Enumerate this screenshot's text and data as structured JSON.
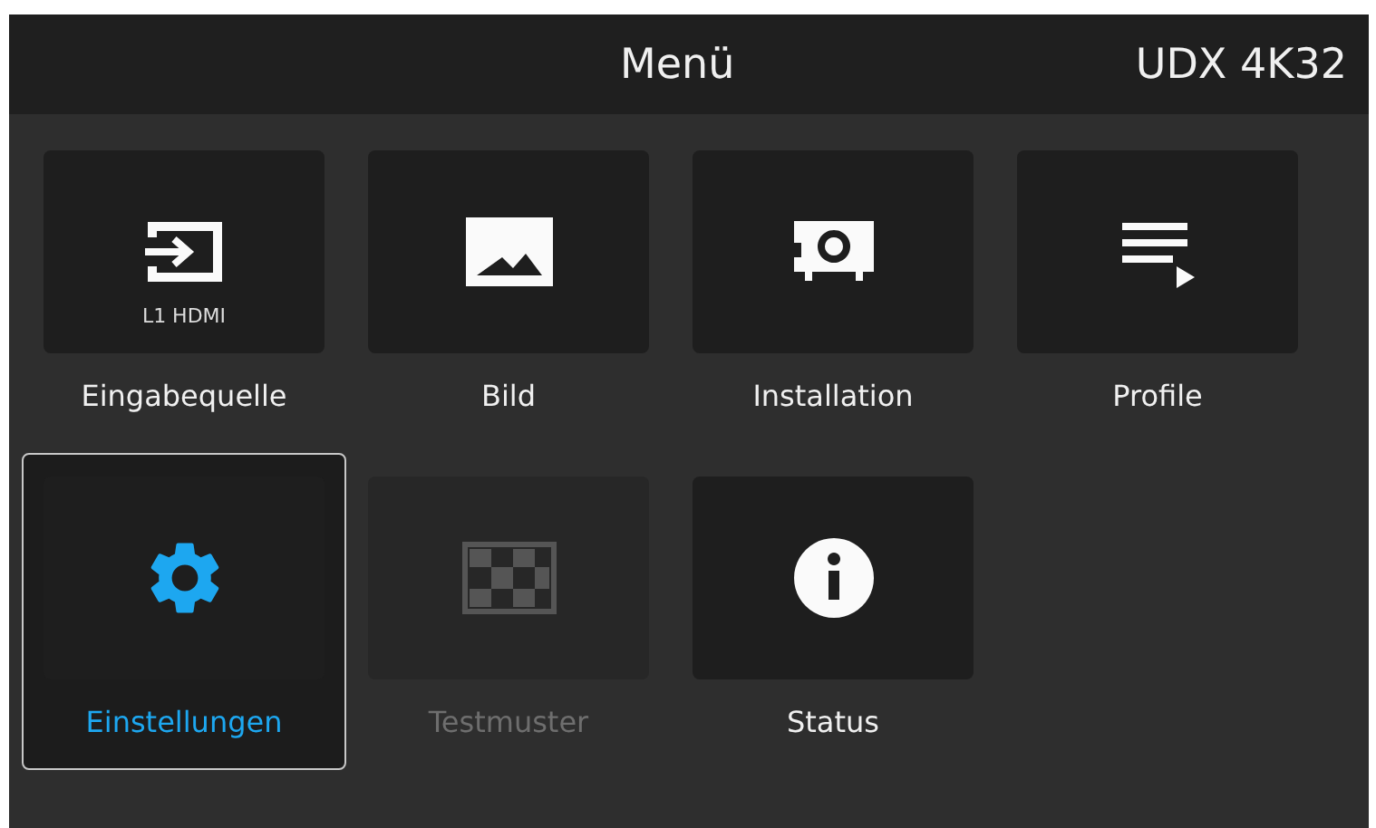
{
  "header": {
    "title": "Menü",
    "model": "UDX 4K32"
  },
  "items": [
    {
      "label": "Eingabequelle",
      "kind": "input",
      "sublabel": "L1 HDMI",
      "selected": false,
      "disabled": false
    },
    {
      "label": "Bild",
      "kind": "image",
      "selected": false,
      "disabled": false
    },
    {
      "label": "Installation",
      "kind": "projector",
      "selected": false,
      "disabled": false
    },
    {
      "label": "Profile",
      "kind": "list",
      "selected": false,
      "disabled": false
    },
    {
      "label": "Einstellungen",
      "kind": "gear",
      "selected": true,
      "disabled": false
    },
    {
      "label": "Testmuster",
      "kind": "checker",
      "selected": false,
      "disabled": true
    },
    {
      "label": "Status",
      "kind": "info",
      "selected": false,
      "disabled": false
    }
  ]
}
